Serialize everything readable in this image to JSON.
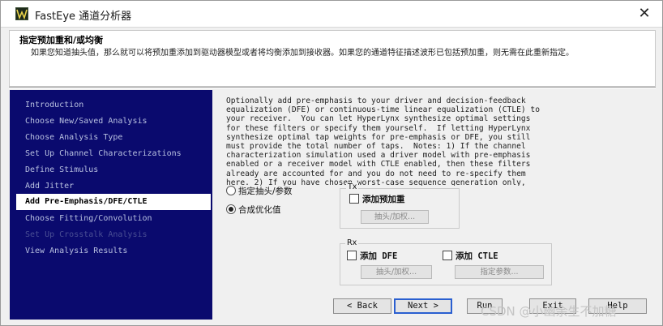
{
  "window": {
    "title": "FastEye 通道分析器",
    "close_glyph": "✕"
  },
  "header": {
    "title": "指定预加重和/或均衡",
    "description": "如果您知道抽头值，那么就可以将预加重添加到驱动器模型或者将均衡添加到接收器。如果您的通道特征描述波形已包括预加重，则无需在此重新指定。"
  },
  "nav": {
    "items": [
      {
        "label": "Introduction",
        "state": "normal"
      },
      {
        "label": "Choose New/Saved Analysis",
        "state": "normal"
      },
      {
        "label": "Choose Analysis Type",
        "state": "normal"
      },
      {
        "label": "Set Up Channel Characterizations",
        "state": "normal"
      },
      {
        "label": "Define Stimulus",
        "state": "normal"
      },
      {
        "label": "Add Jitter",
        "state": "normal"
      },
      {
        "label": "Add Pre-Emphasis/DFE/CTLE",
        "state": "active"
      },
      {
        "label": "Choose Fitting/Convolution",
        "state": "normal"
      },
      {
        "label": "Set Up Crosstalk Analysis",
        "state": "disabled"
      },
      {
        "label": "View Analysis Results",
        "state": "normal"
      }
    ]
  },
  "main": {
    "description": "Optionally add pre-emphasis to your driver and decision-feedback\nequalization (DFE) or continuous-time linear equalization (CTLE) to\nyour receiver.  You can let HyperLynx synthesize optimal settings\nfor these filters or specify them yourself.  If letting HyperLynx\nsynthesize optimal tap weights for pre-emphasis or DFE, you still\nmust provide the total number of taps.  Notes: 1) If the channel\ncharacterization simulation used a driver model with pre-emphasis\nenabled or a receiver model with CTLE enabled, then these filters\nalready are accounted for and you do not need to re-specify them\nhere. 2) If you have chosen worst-case sequence generation only,",
    "radio_specify": "指定抽头/参数",
    "radio_optimize": "合成优化值",
    "tx": {
      "label": "Tx",
      "add_preemphasis": "添加预加重",
      "taps_button": "抽头/加权..."
    },
    "rx": {
      "label": "Rx",
      "add_dfe": "添加 DFE",
      "add_ctle": "添加 CTLE",
      "taps_button": "抽头/加权...",
      "params_button": "指定参数..."
    }
  },
  "buttons": {
    "back": "< Back",
    "next": "Next >",
    "run": "Run",
    "exit": "Exit",
    "help": "Help"
  },
  "watermark": "CSDN @小幽余生不加糖"
}
